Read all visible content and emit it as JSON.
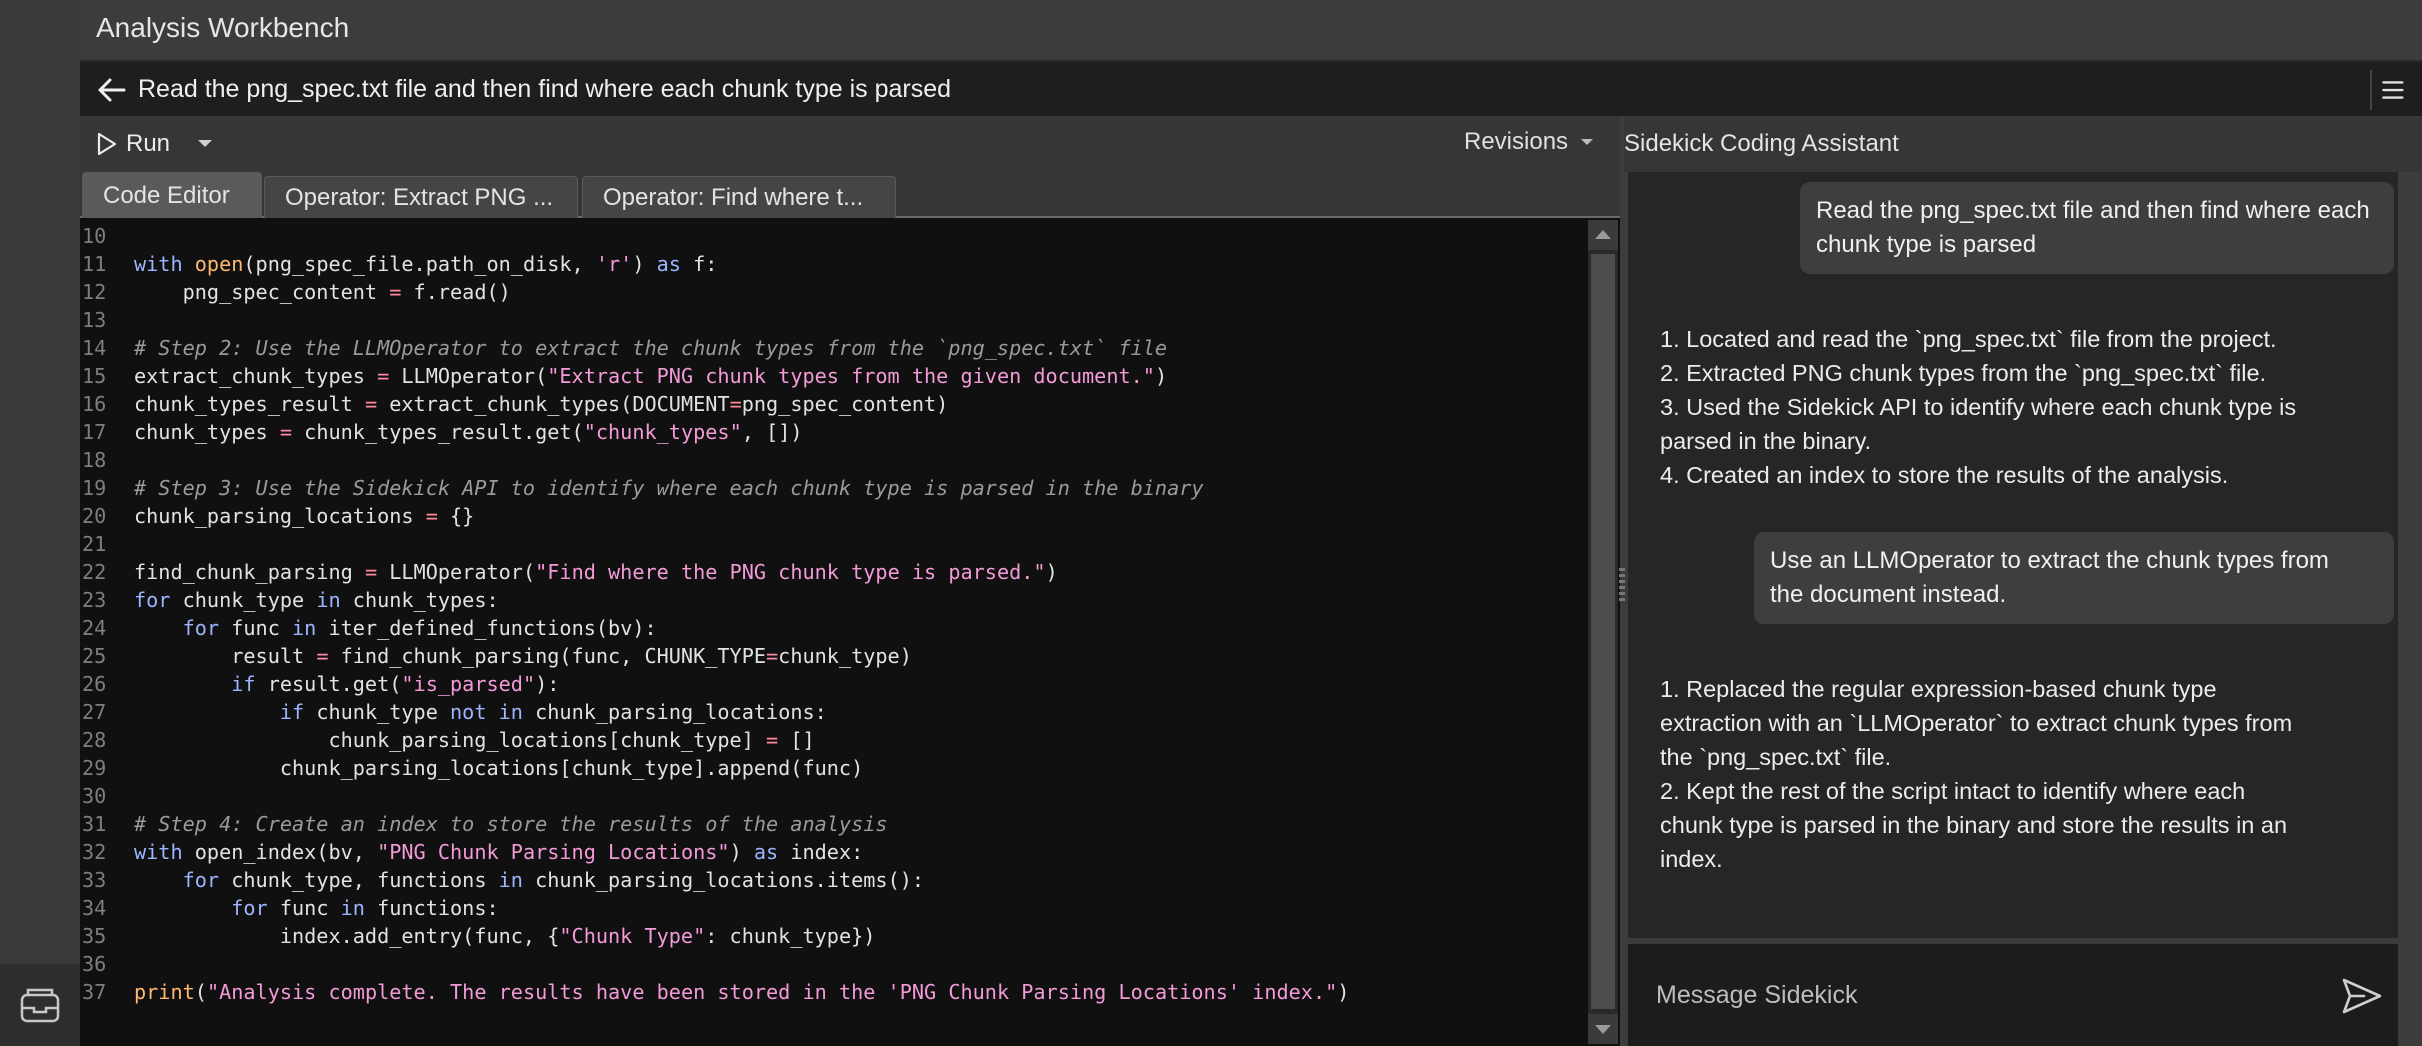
{
  "app": {
    "title": "Analysis Workbench"
  },
  "address_bar": {
    "text": "Read the png_spec.txt file and then find where each chunk type is parsed"
  },
  "toolbar": {
    "run_label": "Run",
    "revisions_label": "Revisions"
  },
  "tabs": [
    {
      "label": "Code Editor",
      "active": true
    },
    {
      "label": "Operator: Extract PNG ...",
      "active": false
    },
    {
      "label": "Operator: Find where t...",
      "active": false
    }
  ],
  "assistant": {
    "title": "Sidekick Coding Assistant",
    "messages": [
      {
        "role": "user",
        "lines": [
          "Read the png_spec.txt file and then find where each",
          "chunk type is parsed"
        ]
      },
      {
        "role": "assistant",
        "lines": [
          "1. Located and read the `png_spec.txt` file from the project.",
          "2. Extracted PNG chunk types from the `png_spec.txt` file.",
          "3. Used the Sidekick API to identify where each chunk type is",
          "parsed in the binary.",
          "4. Created an index to store the results of the analysis."
        ]
      },
      {
        "role": "user",
        "lines": [
          "Use an LLMOperator to extract the chunk types from",
          "the document instead."
        ]
      },
      {
        "role": "assistant",
        "lines": [
          "1. Replaced the regular expression-based chunk type",
          "extraction with an `LLMOperator` to extract chunk types from",
          "the `png_spec.txt` file.",
          "2. Kept the rest of the script intact to identify where each",
          "chunk type is parsed in the binary and store the results in an",
          "index."
        ]
      }
    ],
    "composer_placeholder": "Message Sidekick"
  },
  "code_lines": [
    {
      "n": "10",
      "parts": []
    },
    {
      "n": "11",
      "parts": [
        [
          "kw",
          "with "
        ],
        [
          "fn",
          "open"
        ],
        [
          "ct",
          "(png_spec_file.path_on_disk, "
        ],
        [
          "str",
          "'r'"
        ],
        [
          "ct",
          ") "
        ],
        [
          "kw",
          "as"
        ],
        [
          "ct",
          " f:"
        ]
      ]
    },
    {
      "n": "12",
      "parts": [
        [
          "ct",
          "    png_spec_content "
        ],
        [
          "op",
          "="
        ],
        [
          "ct",
          " f.read()"
        ]
      ]
    },
    {
      "n": "13",
      "parts": []
    },
    {
      "n": "14",
      "parts": [
        [
          "cm",
          "# Step 2: Use the LLMOperator to extract the chunk types from the `png_spec.txt` file"
        ]
      ]
    },
    {
      "n": "15",
      "parts": [
        [
          "ct",
          "extract_chunk_types "
        ],
        [
          "op",
          "="
        ],
        [
          "ct",
          " LLMOperator("
        ],
        [
          "str",
          "\"Extract PNG chunk types from the given document.\""
        ],
        [
          "ct",
          ")"
        ]
      ]
    },
    {
      "n": "16",
      "parts": [
        [
          "ct",
          "chunk_types_result "
        ],
        [
          "op",
          "="
        ],
        [
          "ct",
          " extract_chunk_types(DOCUMENT"
        ],
        [
          "op",
          "="
        ],
        [
          "ct",
          "png_spec_content)"
        ]
      ]
    },
    {
      "n": "17",
      "parts": [
        [
          "ct",
          "chunk_types "
        ],
        [
          "op",
          "="
        ],
        [
          "ct",
          " chunk_types_result.get("
        ],
        [
          "str",
          "\"chunk_types\""
        ],
        [
          "ct",
          ", [])"
        ]
      ]
    },
    {
      "n": "18",
      "parts": []
    },
    {
      "n": "19",
      "parts": [
        [
          "cm",
          "# Step 3: Use the Sidekick API to identify where each chunk type is parsed in the binary"
        ]
      ]
    },
    {
      "n": "20",
      "parts": [
        [
          "ct",
          "chunk_parsing_locations "
        ],
        [
          "op",
          "="
        ],
        [
          "ct",
          " {}"
        ]
      ]
    },
    {
      "n": "21",
      "parts": []
    },
    {
      "n": "22",
      "parts": [
        [
          "ct",
          "find_chunk_parsing "
        ],
        [
          "op",
          "="
        ],
        [
          "ct",
          " LLMOperator("
        ],
        [
          "str",
          "\"Find where the PNG chunk type is parsed.\""
        ],
        [
          "ct",
          ")"
        ]
      ]
    },
    {
      "n": "23",
      "parts": [
        [
          "kw",
          "for"
        ],
        [
          "ct",
          " chunk_type "
        ],
        [
          "kw",
          "in"
        ],
        [
          "ct",
          " chunk_types:"
        ]
      ]
    },
    {
      "n": "24",
      "parts": [
        [
          "ct",
          "    "
        ],
        [
          "kw",
          "for"
        ],
        [
          "ct",
          " func "
        ],
        [
          "kw",
          "in"
        ],
        [
          "ct",
          " iter_defined_functions(bv):"
        ]
      ]
    },
    {
      "n": "25",
      "parts": [
        [
          "ct",
          "        result "
        ],
        [
          "op",
          "="
        ],
        [
          "ct",
          " find_chunk_parsing(func, CHUNK_TYPE"
        ],
        [
          "op",
          "="
        ],
        [
          "ct",
          "chunk_type)"
        ]
      ]
    },
    {
      "n": "26",
      "parts": [
        [
          "ct",
          "        "
        ],
        [
          "kw",
          "if"
        ],
        [
          "ct",
          " result.get("
        ],
        [
          "str",
          "\"is_parsed\""
        ],
        [
          "ct",
          "):"
        ]
      ]
    },
    {
      "n": "27",
      "parts": [
        [
          "ct",
          "            "
        ],
        [
          "kw",
          "if"
        ],
        [
          "ct",
          " chunk_type "
        ],
        [
          "kw",
          "not in"
        ],
        [
          "ct",
          " chunk_parsing_locations:"
        ]
      ]
    },
    {
      "n": "28",
      "parts": [
        [
          "ct",
          "                chunk_parsing_locations[chunk_type] "
        ],
        [
          "op",
          "="
        ],
        [
          "ct",
          " []"
        ]
      ]
    },
    {
      "n": "29",
      "parts": [
        [
          "ct",
          "            chunk_parsing_locations[chunk_type].append(func)"
        ]
      ]
    },
    {
      "n": "30",
      "parts": []
    },
    {
      "n": "31",
      "parts": [
        [
          "cm",
          "# Step 4: Create an index to store the results of the analysis"
        ]
      ]
    },
    {
      "n": "32",
      "parts": [
        [
          "kw",
          "with"
        ],
        [
          "ct",
          " open_index(bv, "
        ],
        [
          "str",
          "\"PNG Chunk Parsing Locations\""
        ],
        [
          "ct",
          ") "
        ],
        [
          "kw",
          "as"
        ],
        [
          "ct",
          " index:"
        ]
      ]
    },
    {
      "n": "33",
      "parts": [
        [
          "ct",
          "    "
        ],
        [
          "kw",
          "for"
        ],
        [
          "ct",
          " chunk_type, functions "
        ],
        [
          "kw",
          "in"
        ],
        [
          "ct",
          " chunk_parsing_locations.items():"
        ]
      ]
    },
    {
      "n": "34",
      "parts": [
        [
          "ct",
          "        "
        ],
        [
          "kw",
          "for"
        ],
        [
          "ct",
          " func "
        ],
        [
          "kw",
          "in"
        ],
        [
          "ct",
          " functions:"
        ]
      ]
    },
    {
      "n": "35",
      "parts": [
        [
          "ct",
          "            index.add_entry(func, {"
        ],
        [
          "str",
          "\"Chunk Type\""
        ],
        [
          "ct",
          ": chunk_type})"
        ]
      ]
    },
    {
      "n": "36",
      "parts": []
    },
    {
      "n": "37",
      "parts": [
        [
          "fn",
          "print"
        ],
        [
          "ct",
          "("
        ],
        [
          "str",
          "\"Analysis complete. The results have been stored in the 'PNG Chunk Parsing Locations' index.\""
        ],
        [
          "ct",
          ")"
        ]
      ]
    }
  ],
  "icons": {
    "back": "arrow-left-icon",
    "menu": "hamburger-icon",
    "run": "play-icon",
    "dropdown": "chevron-down-icon",
    "send": "send-icon",
    "rail": "archive-icon"
  }
}
